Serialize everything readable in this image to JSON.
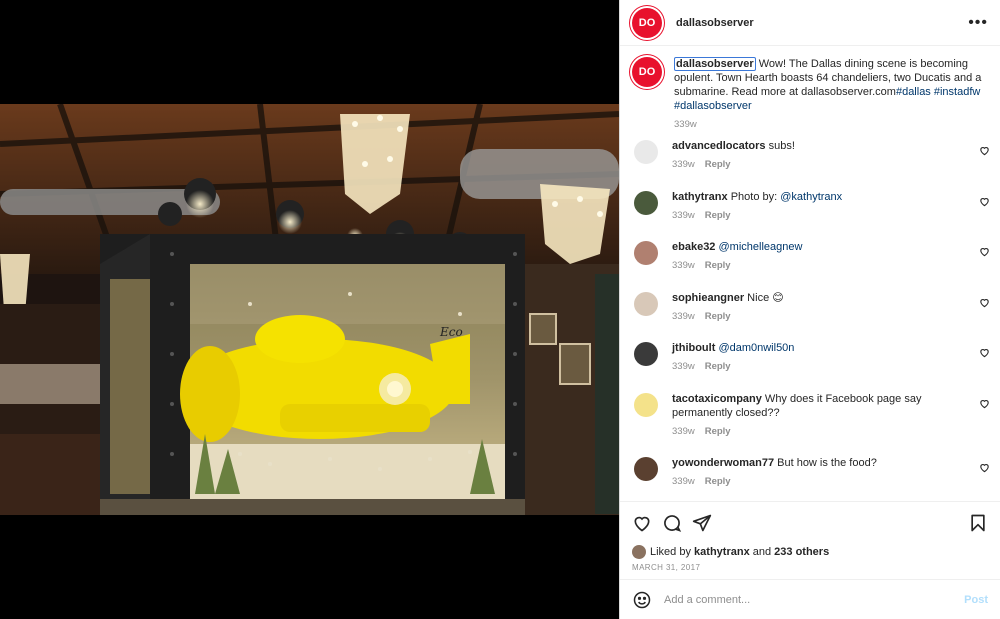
{
  "post": {
    "username": "dallasobserver",
    "avatar_text": "DO",
    "brand_color": "#e8112d",
    "caption": {
      "username": "dallasobserver",
      "text": " Wow! The Dallas dining scene is becoming opulent. Town Hearth boasts 64 chandeliers, two Ducatis and a submarine. Read more at dallasobserver.com",
      "hashtags": [
        "#dallas",
        "#instadfw",
        "#dallasobserver"
      ],
      "age": "339w"
    },
    "comments": [
      {
        "username": "advancedlocators",
        "text": " subs!",
        "mention": "",
        "age": "339w",
        "reply": "Reply",
        "avatar_color": "#e9e9e9"
      },
      {
        "username": "kathytranx",
        "text": " Photo by: ",
        "mention": "@kathytranx",
        "age": "339w",
        "reply": "Reply",
        "avatar_color": "#4a5a3c"
      },
      {
        "username": "ebake32",
        "text": " ",
        "mention": "@michelleagnew",
        "age": "339w",
        "reply": "Reply",
        "avatar_color": "#b08070"
      },
      {
        "username": "sophieangner",
        "text": " Nice 😊",
        "mention": "",
        "age": "339w",
        "reply": "Reply",
        "avatar_color": "#d8c8b8"
      },
      {
        "username": "jthiboult",
        "text": " ",
        "mention": "@dam0nwil50n",
        "age": "339w",
        "reply": "Reply",
        "avatar_color": "#3a3a3a"
      },
      {
        "username": "tacotaxicompany",
        "text": " Why does it Facebook page say permanently closed??",
        "mention": "",
        "age": "339w",
        "reply": "Reply",
        "avatar_color": "#f4e28a"
      },
      {
        "username": "yowonderwoman77",
        "text": " But how is the food?",
        "mention": "",
        "age": "339w",
        "reply": "Reply",
        "avatar_color": "#5a4030"
      }
    ],
    "actions": {
      "icons": [
        "heart-icon",
        "comment-icon",
        "share-icon",
        "bookmark-icon"
      ]
    },
    "likes": {
      "prefix": "Liked by ",
      "user": "kathytranx",
      "middle": " and ",
      "others": "233 others"
    },
    "date": "MARCH 31, 2017",
    "comment_input": {
      "placeholder": "Add a comment...",
      "post_label": "Post"
    }
  }
}
